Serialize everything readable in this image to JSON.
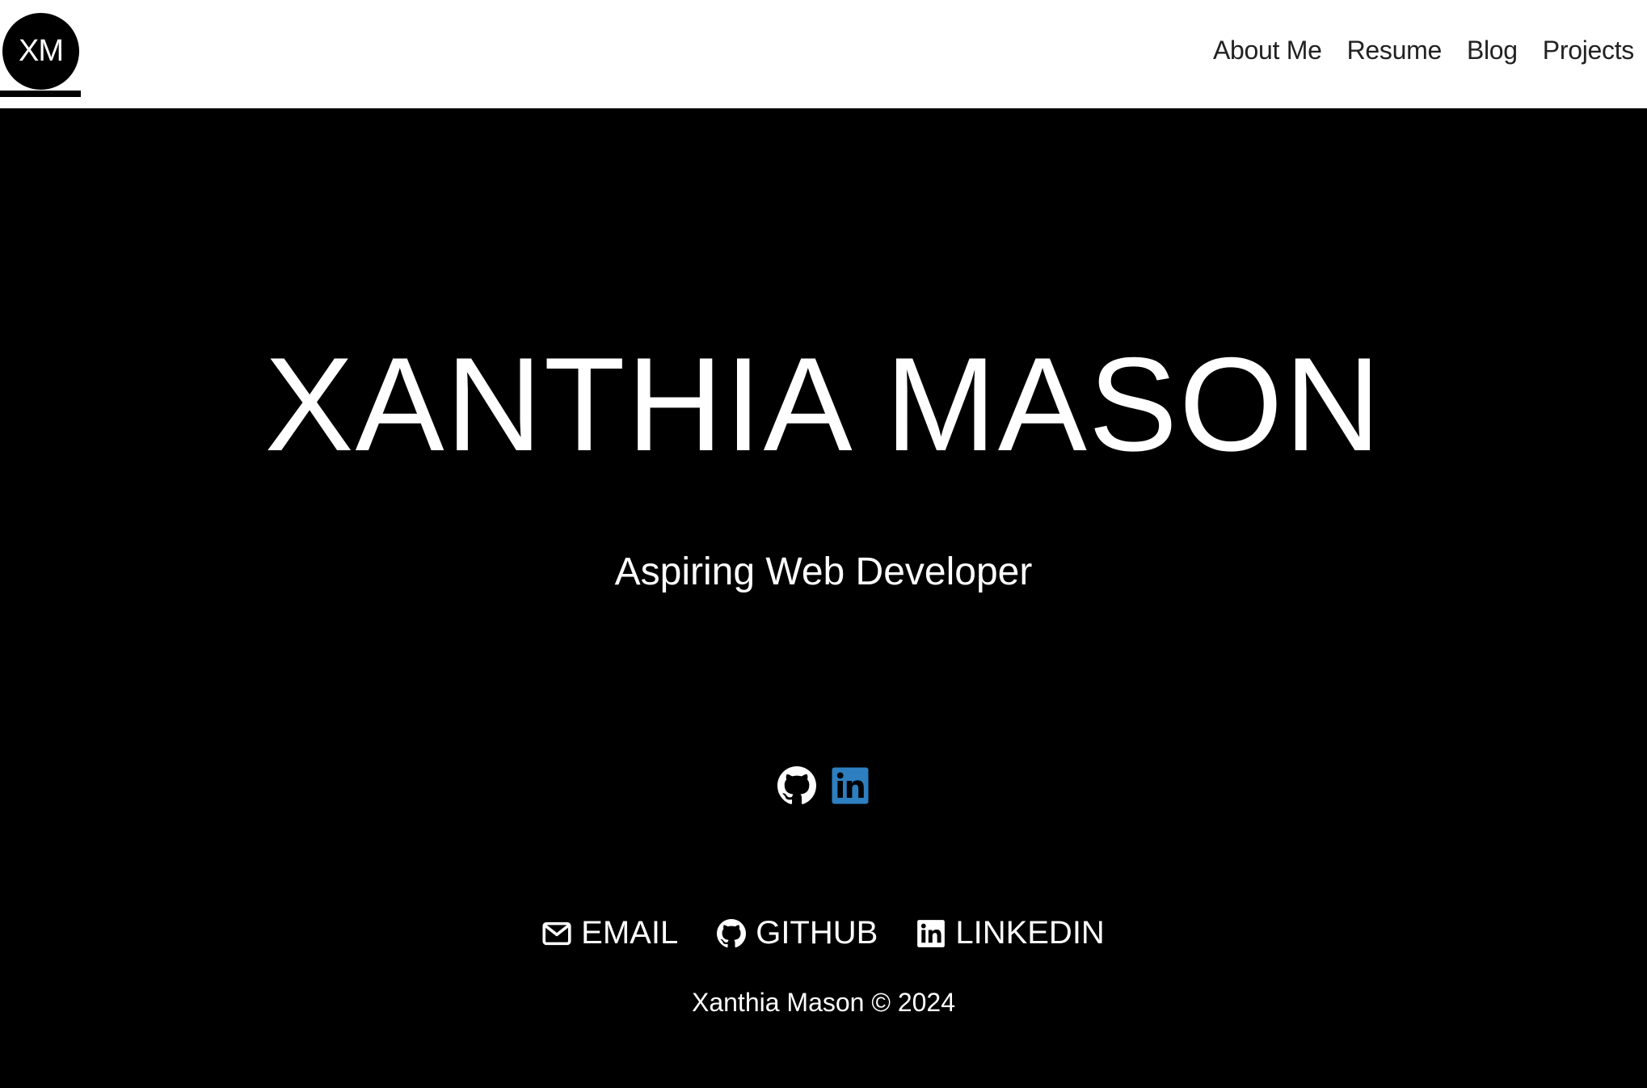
{
  "header": {
    "logo_text": "XM",
    "nav": [
      {
        "label": "About Me"
      },
      {
        "label": "Resume"
      },
      {
        "label": "Blog"
      },
      {
        "label": "Projects"
      }
    ]
  },
  "hero": {
    "name": "XANTHIA MASON",
    "tagline": "Aspiring Web Developer",
    "icons": [
      "github-icon",
      "linkedin-icon"
    ]
  },
  "footer": {
    "links": [
      {
        "label": "EMAIL",
        "icon": "envelope-icon"
      },
      {
        "label": "GITHUB",
        "icon": "github-icon"
      },
      {
        "label": "LINKEDIN",
        "icon": "linkedin-icon"
      }
    ],
    "copyright": "Xanthia Mason © 2024"
  },
  "colors": {
    "background": "#000000",
    "header_bg": "#ffffff",
    "text_light": "#ffffff",
    "text_dark": "#222222",
    "linkedin_blue": "#2d7fc0"
  }
}
